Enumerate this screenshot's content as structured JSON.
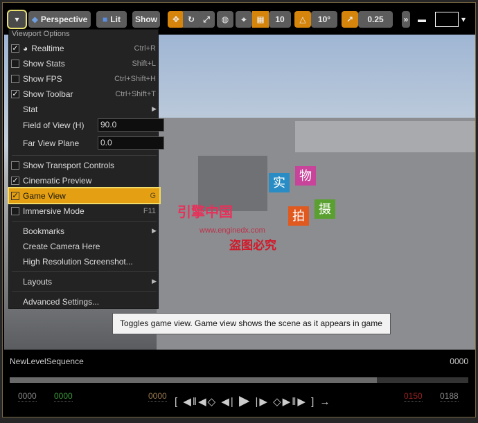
{
  "toolbar": {
    "perspective": "Perspective",
    "lit": "Lit",
    "show": "Show",
    "grid_snap": "10",
    "rotation_snap": "10°",
    "scale_snap": "0.25",
    "accent": "#d5850b"
  },
  "menu": {
    "header": "Viewport Options",
    "realtime": {
      "label": "Realtime",
      "shortcut": "Ctrl+R",
      "checked": true
    },
    "stats": {
      "label": "Show Stats",
      "shortcut": "Shift+L",
      "checked": false
    },
    "fps": {
      "label": "Show FPS",
      "shortcut": "Ctrl+Shift+H",
      "checked": false
    },
    "toolbar": {
      "label": "Show Toolbar",
      "shortcut": "Ctrl+Shift+T",
      "checked": true
    },
    "stat": {
      "label": "Stat"
    },
    "fov": {
      "label": "Field of View (H)",
      "value": "90.0"
    },
    "far": {
      "label": "Far View Plane",
      "value": "0.0"
    },
    "transport": {
      "label": "Show Transport Controls",
      "checked": false
    },
    "cinematic": {
      "label": "Cinematic Preview",
      "checked": true
    },
    "gameview": {
      "label": "Game View",
      "shortcut": "G",
      "checked": true
    },
    "immersive": {
      "label": "Immersive Mode",
      "shortcut": "F11",
      "checked": false
    },
    "bookmarks": {
      "label": "Bookmarks"
    },
    "camera": {
      "label": "Create Camera Here"
    },
    "hires": {
      "label": "High Resolution Screenshot..."
    },
    "layouts": {
      "label": "Layouts"
    },
    "advanced": {
      "label": "Advanced Settings..."
    }
  },
  "tooltip": "Toggles game view.  Game view shows the scene as it appears in game",
  "watermark": {
    "line1": "引擎中国",
    "line2": "www.enginedx.com",
    "line3": "盗图必究",
    "tags": [
      "实",
      "物",
      "拍",
      "摄"
    ]
  },
  "sequencer": {
    "name": "NewLevelSequence",
    "current": "0000",
    "start_view": "0000",
    "start": "0000",
    "frame": "0000",
    "end": "0150",
    "end_view": "0188",
    "progress": 0.8
  }
}
